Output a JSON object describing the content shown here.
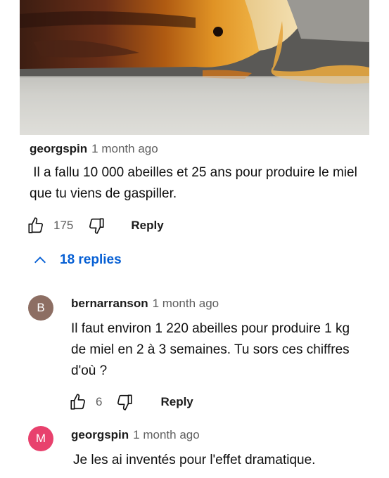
{
  "comments": {
    "top": {
      "author": "georgspin",
      "time": "1 month ago",
      "text": " Il a fallu 10 000 abeilles et 25 ans pour produire le miel que tu viens de gaspiller.",
      "likes": "175",
      "reply_label": "Reply"
    },
    "replies_toggle": {
      "label": "18 replies",
      "icon": "chevron-up-icon",
      "color": "#065fd4"
    },
    "replies": [
      {
        "avatar_letter": "B",
        "avatar_color": "#8d6e63",
        "author": "bernarranson",
        "time": "1 month ago",
        "text": "Il faut environ 1 220 abeilles pour produire 1 kg de miel en 2 à 3 semaines. Tu sors ces chiffres d'où ?",
        "likes": "6",
        "reply_label": "Reply"
      },
      {
        "avatar_letter": "M",
        "avatar_color": "#e8416d",
        "author": "georgspin",
        "time": "1 month ago",
        "text": "Je les ai inventés pour l'effet dramatique."
      }
    ]
  }
}
